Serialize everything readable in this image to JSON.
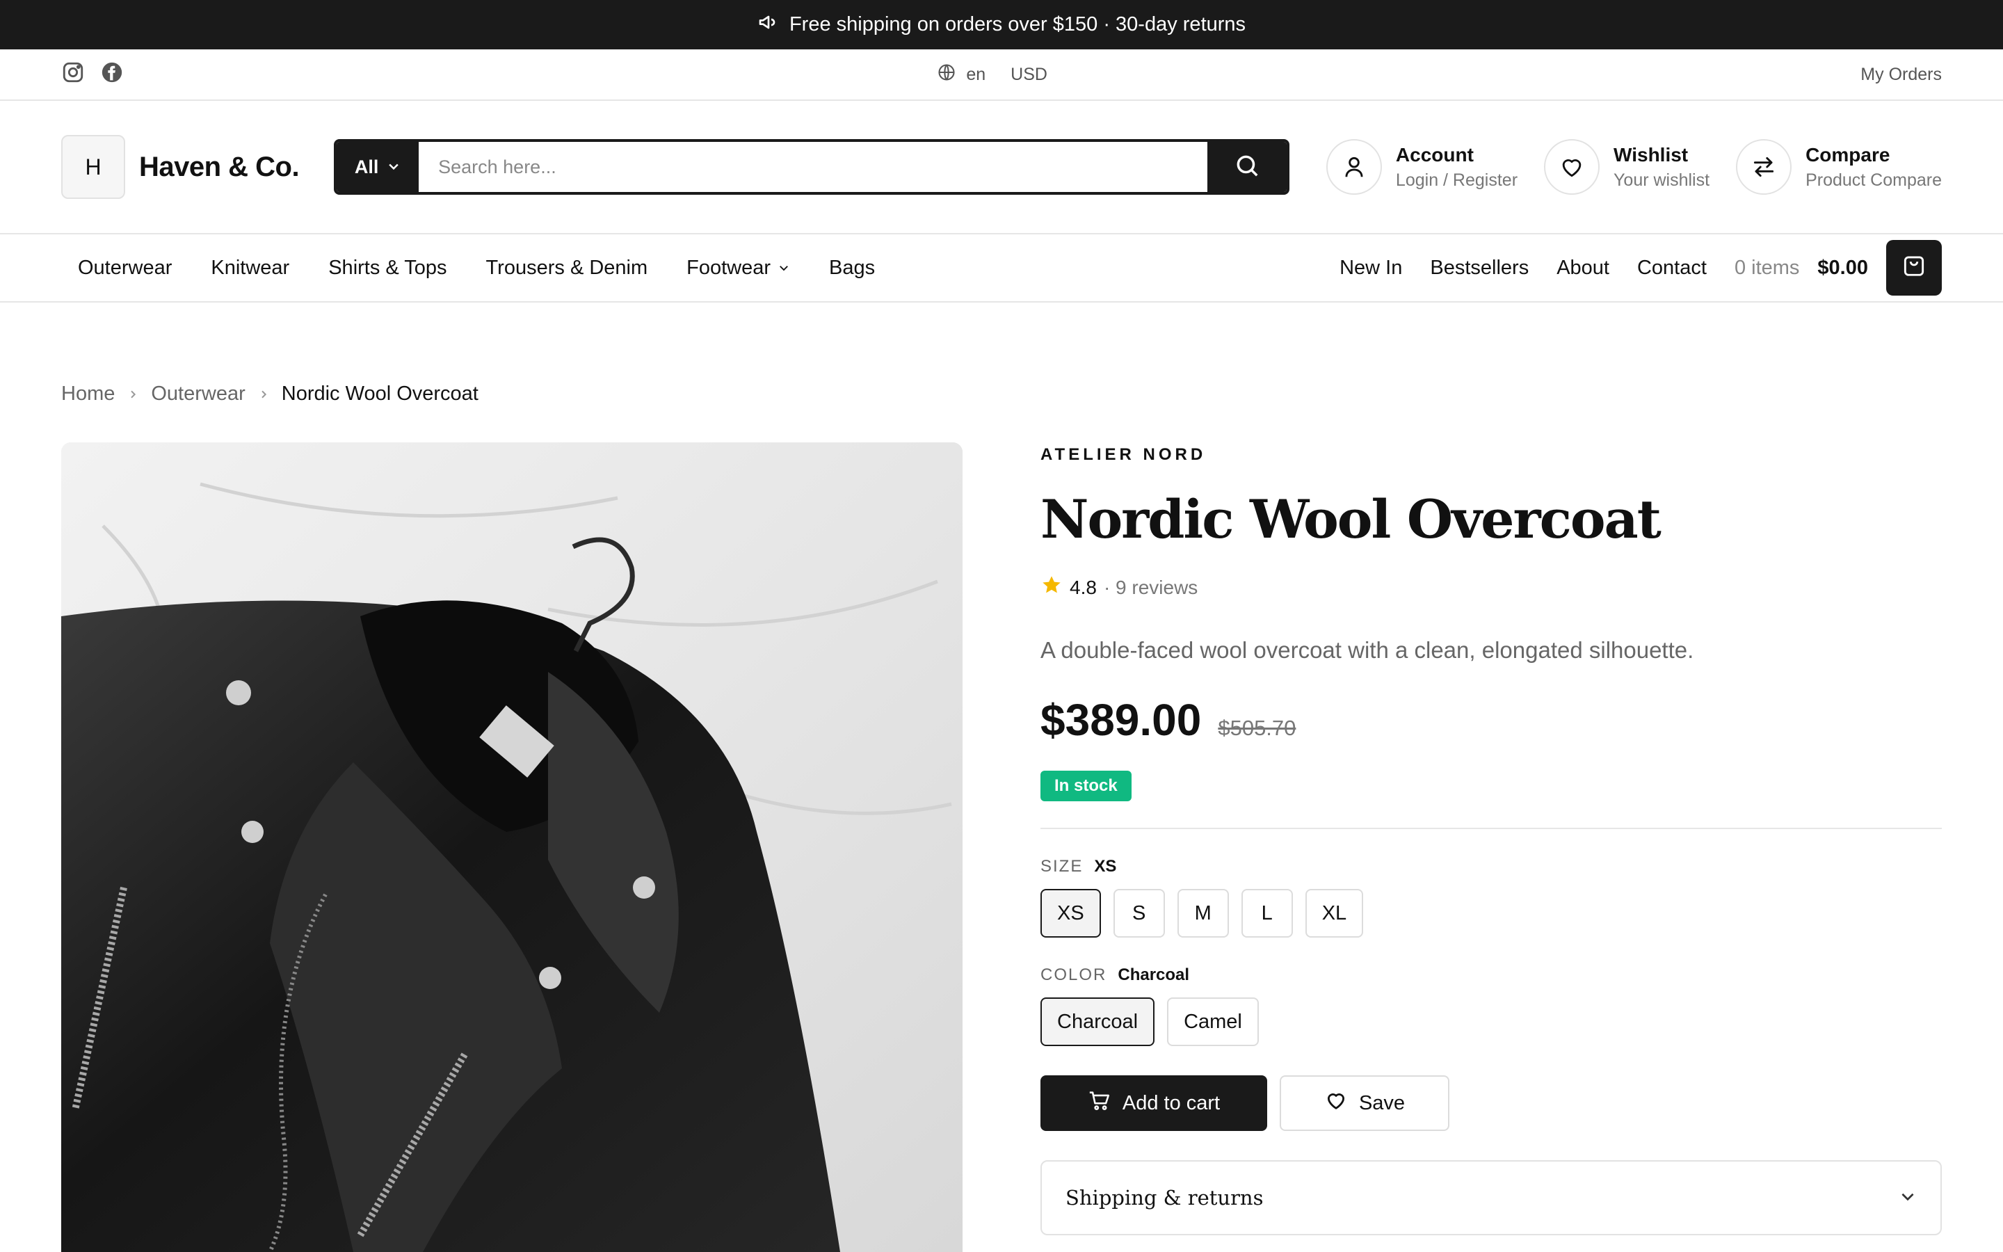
{
  "announcement": {
    "text": "Free shipping on orders over $150 · 30-day returns"
  },
  "utility": {
    "language": "en",
    "currency": "USD",
    "my_orders": "My Orders"
  },
  "header": {
    "logo_letter": "H",
    "brand": "Haven & Co.",
    "search": {
      "category": "All",
      "placeholder": "Search here..."
    },
    "account": {
      "title": "Account",
      "subtitle": "Login / Register"
    },
    "wishlist": {
      "title": "Wishlist",
      "subtitle": "Your wishlist"
    },
    "compare": {
      "title": "Compare",
      "subtitle": "Product Compare"
    }
  },
  "nav": {
    "categories": [
      "Outerwear",
      "Knitwear",
      "Shirts & Tops",
      "Trousers & Denim",
      "Footwear",
      "Bags"
    ],
    "links": [
      "New In",
      "Bestsellers",
      "About",
      "Contact"
    ],
    "cart_count": "0 items",
    "cart_total": "$0.00"
  },
  "breadcrumb": [
    "Home",
    "Outerwear",
    "Nordic Wool Overcoat"
  ],
  "product": {
    "brand": "ATELIER NORD",
    "title": "Nordic Wool Overcoat",
    "rating": "4.8",
    "reviews": "· 9 reviews",
    "description": "A double-faced wool overcoat with a clean, elongated silhouette.",
    "price": "$389.00",
    "old_price": "$505.70",
    "stock": "In stock",
    "size": {
      "label": "SIZE",
      "selected": "XS",
      "options": [
        "XS",
        "S",
        "M",
        "L",
        "XL"
      ]
    },
    "color": {
      "label": "COLOR",
      "selected": "Charcoal",
      "options": [
        "Charcoal",
        "Camel"
      ]
    },
    "add_to_cart": "Add to cart",
    "save": "Save",
    "shipping": "Shipping & returns"
  },
  "colors": {
    "dark": "#1a1a1a",
    "stock": "#10b981",
    "star": "#f5b800"
  }
}
